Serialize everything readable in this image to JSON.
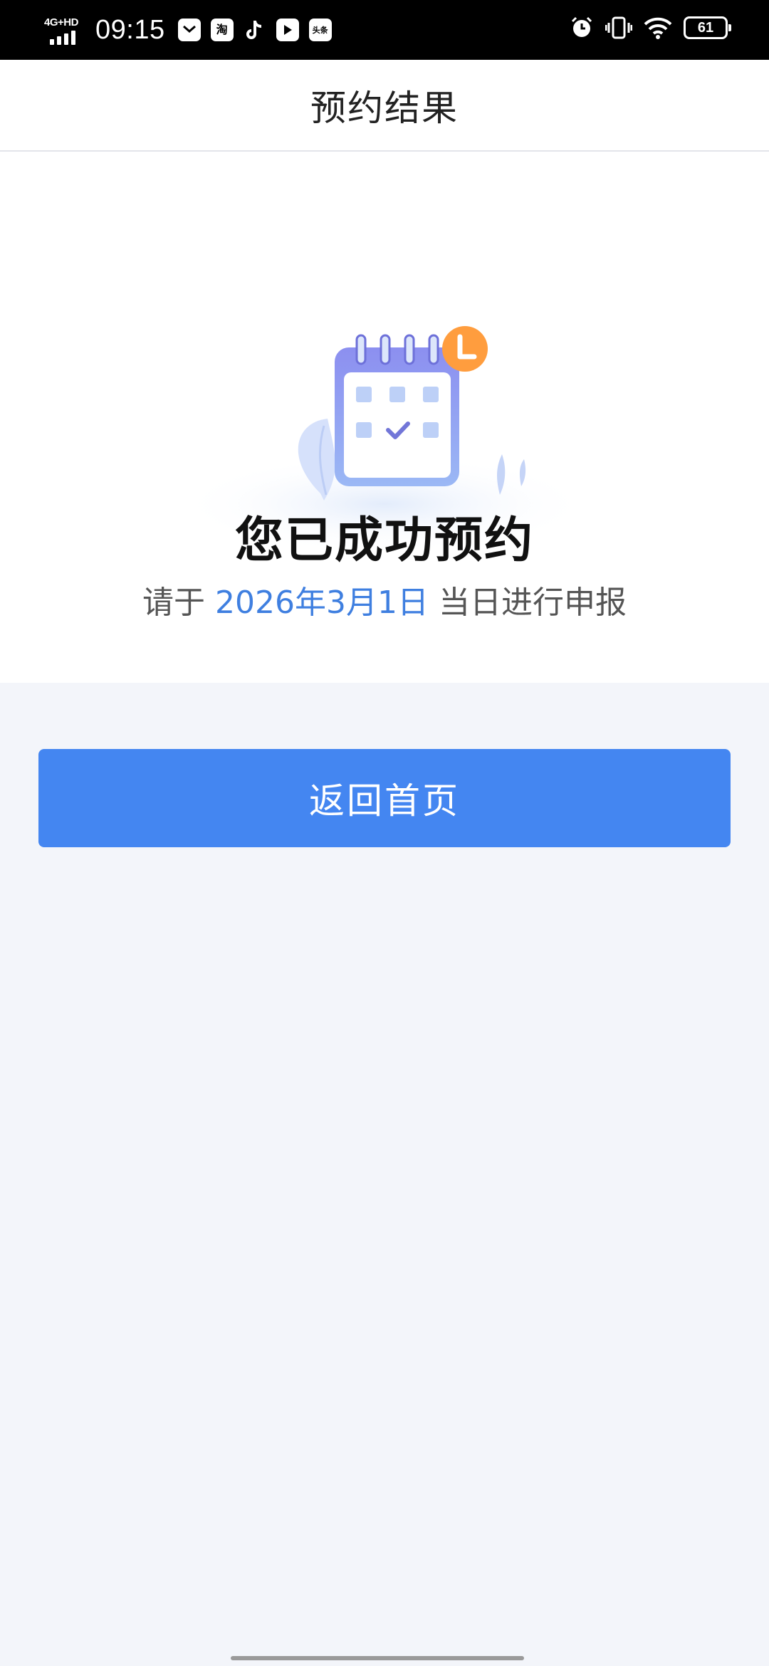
{
  "status_bar": {
    "network": "4G+HD",
    "time": "09:15",
    "app_icons": [
      "mail-icon",
      "taobao-icon",
      "tiktok-icon",
      "video-icon",
      "toutiao-icon"
    ],
    "taobao_label": "淘",
    "toutiao_label": "头条",
    "battery": "61"
  },
  "header": {
    "title": "预约结果"
  },
  "result": {
    "title": "您已成功预约",
    "prefix": "请于",
    "date": "2026年3月1日",
    "suffix": "当日进行申报"
  },
  "actions": {
    "home_label": "返回首页"
  },
  "colors": {
    "primary": "#4486f1",
    "date_text": "#3f7fe0",
    "page_bg": "#f3f5fa",
    "clock_badge": "#ff9d3e"
  }
}
